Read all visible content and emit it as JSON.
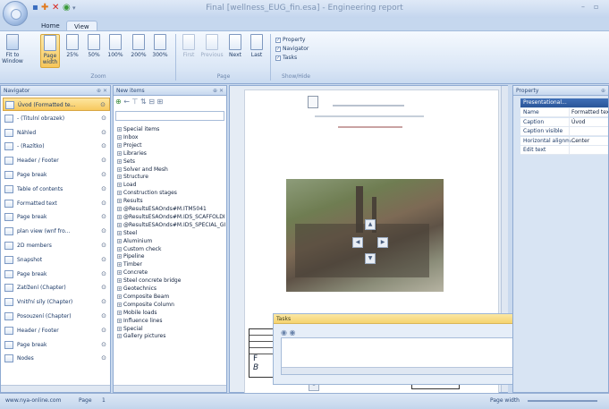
{
  "window": {
    "title": "Final [wellness_EUG_fin.esa] - Engineering report"
  },
  "ribbon": {
    "tabs": [
      "Home",
      "View"
    ],
    "zoom_buttons": [
      "Fit to Window",
      "Page width",
      "25%",
      "50%",
      "100%",
      "200%",
      "300%"
    ],
    "page_buttons": [
      "First",
      "Previous",
      "Next",
      "Last"
    ],
    "show_hide": [
      "Property",
      "Navigator",
      "Tasks"
    ],
    "groups": {
      "zoom": "Zoom",
      "page": "Page",
      "show_hide": "Show/Hide"
    }
  },
  "navigator": {
    "title": "Navigator",
    "items": [
      {
        "label": "Úvod (Formatted te..."
      },
      {
        "label": "- (Titulní obrazek)"
      },
      {
        "label": "Náhled"
      },
      {
        "label": "- (Razítko)"
      },
      {
        "label": "Header / Footer"
      },
      {
        "label": "Page break"
      },
      {
        "label": "Table of contents"
      },
      {
        "label": "Formatted text"
      },
      {
        "label": "Page break"
      },
      {
        "label": "plan view (wnf fro..."
      },
      {
        "label": "2D members"
      },
      {
        "label": "Snapshot"
      },
      {
        "label": "Page break"
      },
      {
        "label": "Zatížení (Chapter)"
      },
      {
        "label": "Vnitřní síly (Chapter)"
      },
      {
        "label": "Posouzení (Chapter)"
      },
      {
        "label": "Header / Footer"
      },
      {
        "label": "Page break"
      },
      {
        "label": "Nodes"
      }
    ]
  },
  "new_items": {
    "title": "New items",
    "items": [
      "Special items",
      "Inbox",
      "Project",
      "Libraries",
      "Sets",
      "Solver and Mesh",
      "Structure",
      "Load",
      "Construction stages",
      "Results",
      "@ResultsESAOnds#M.ITM5041",
      "@ResultsESAOnds#M.IDS_SCAFFOLDI",
      "@ResultsESAOnds#M.IDS_SPECIAL_GI",
      "Steel",
      "Aluminium",
      "Custom check",
      "Pipeline",
      "Timber",
      "Concrete",
      "Steel concrete bridge",
      "Geotechnics",
      "Composite Beam",
      "Composite Column",
      "Mobile loads",
      "Influence lines",
      "Special",
      "Gallery pictures"
    ]
  },
  "document": {
    "tasks_title": "Tasks",
    "letter_f": "F",
    "letter_b": "B"
  },
  "property": {
    "title": "Property",
    "section": "Presentational...",
    "rows": [
      {
        "key": "Name",
        "value": "Formatted text"
      },
      {
        "key": "Caption",
        "value": "Úvod"
      },
      {
        "key": "Caption visible",
        "value": ""
      },
      {
        "key": "Horizontal alignm...",
        "value": "Center"
      },
      {
        "key": "Edit text",
        "value": ""
      }
    ]
  },
  "status": {
    "left": "www.nya-online.com",
    "page_label": "Page",
    "page_value": "1",
    "right": "Page width"
  }
}
